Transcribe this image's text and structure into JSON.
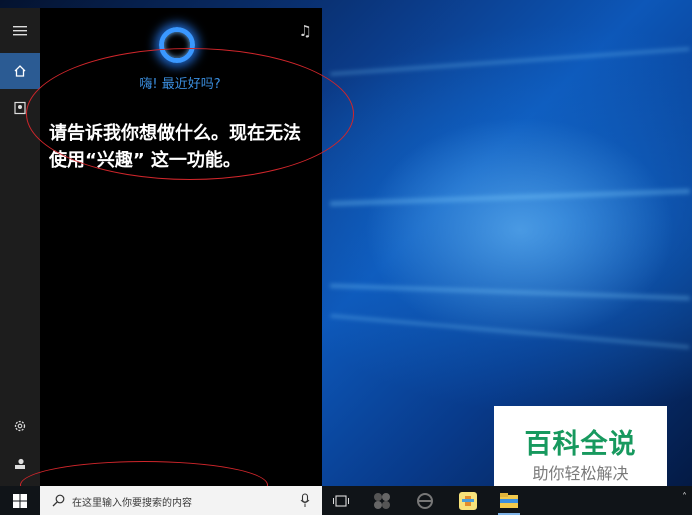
{
  "cortana": {
    "greeting": "嗨! 最近好吗?",
    "message": "请告诉我你想做什么。现在无法使用“兴趣” 这一功能。"
  },
  "rail": {
    "items": [
      "hamburger-icon",
      "home-icon",
      "notebook-icon",
      "settings-icon",
      "feedback-icon"
    ]
  },
  "taskbar": {
    "search_placeholder": "在这里输入你要搜索的内容"
  },
  "watermark": {
    "title": "百科全说",
    "subtitle": "助你轻松解决"
  },
  "colors": {
    "accent": "#3b8fe0",
    "annotation": "#d0262b",
    "watermark_green": "#17995e"
  }
}
